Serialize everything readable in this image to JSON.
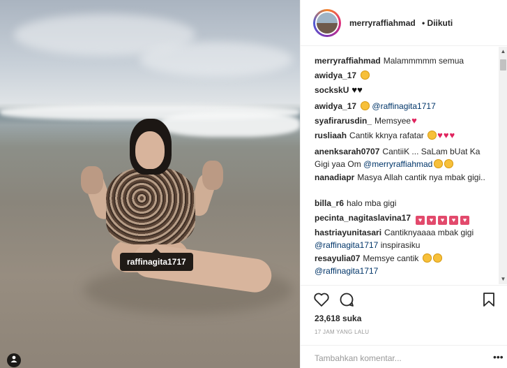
{
  "photo": {
    "alt_tag": "raffinagita1717"
  },
  "header": {
    "username": "merryraffiahmad",
    "follow_state": "• Diikuti"
  },
  "comments": [
    {
      "user": "merryraffiahmad",
      "text": "Malammmmm semua"
    },
    {
      "user": "awidya_17",
      "text": "",
      "emoji": [
        "heart-eyes"
      ]
    },
    {
      "user": "sockskU",
      "text": "",
      "emoji": [
        "black-heart",
        "black-heart"
      ]
    },
    {
      "user": "awidya_17",
      "text": "",
      "emoji": [
        "heart-eyes"
      ],
      "mention": "@raffinagita1717"
    },
    {
      "user": "syafirarusdin_",
      "text": "Memsyee",
      "emoji": [
        "red-heart"
      ]
    },
    {
      "user": "rusliaah",
      "text": "Cantik kknya rafatar",
      "emoji": [
        "grin",
        "red-heart",
        "red-heart",
        "red-heart"
      ]
    },
    {
      "user": "anenksarah0707",
      "text": "CantiiK ... SaLam bUat Ka Gigi yaa Om",
      "mention": "@merryraffiahmad",
      "emoji": [
        "kiss",
        "kiss"
      ]
    },
    {
      "user": "nanadiapr",
      "text": "Masya Allah cantik nya mbak gigi.."
    },
    {
      "user": "billa_r6",
      "text": "halo mba gigi"
    },
    {
      "user": "pecinta_nagitaslavina17",
      "text": "",
      "emoji": [
        "heart-box",
        "heart-box",
        "heart-box",
        "heart-box",
        "heart-box"
      ]
    },
    {
      "user": "hastriayunitasari",
      "text": "Cantiknyaaaa mbak gigi",
      "mention": "@raffinagita1717",
      "tail": "inspirasiku"
    },
    {
      "user": "resayulia07",
      "text": "Memsye cantik",
      "emoji": [
        "kiss",
        "kiss"
      ],
      "mention": "@raffinagita1717"
    }
  ],
  "likes": "23,618 suka",
  "timestamp": "17 JAM YANG LALU",
  "comment_input": {
    "placeholder": "Tambahkan komentar..."
  },
  "more_label": "•••",
  "icons": [
    "heart-icon",
    "comment-icon",
    "bookmark-icon",
    "user-tag-icon"
  ]
}
